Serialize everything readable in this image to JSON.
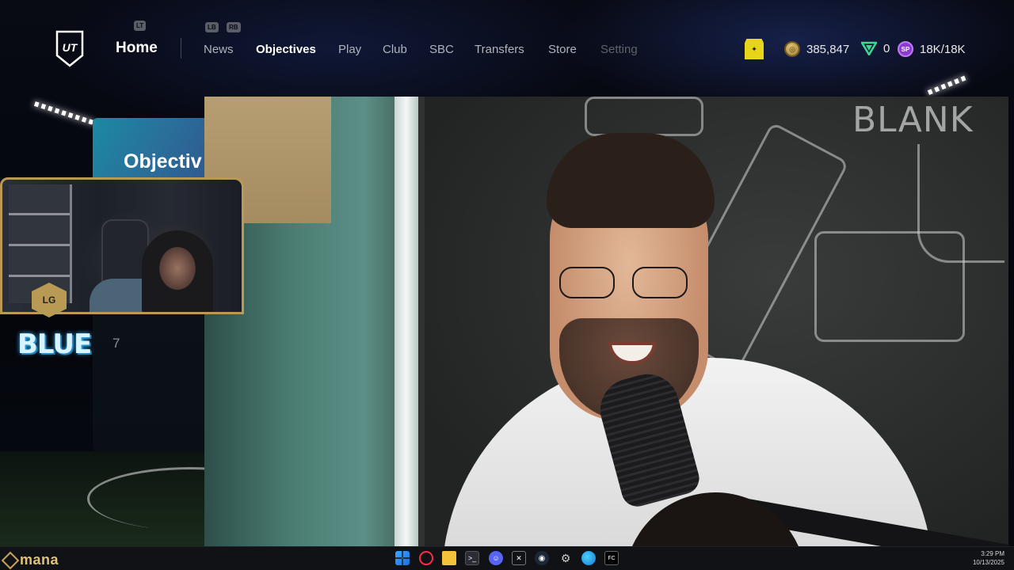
{
  "nav": {
    "home": "Home",
    "lt": "LT",
    "lb": "LB",
    "rb": "RB",
    "items": [
      "News",
      "Objectives",
      "Play",
      "Club",
      "SBC",
      "Transfers",
      "Store",
      "Setting"
    ],
    "active": "Objectives"
  },
  "currencies": {
    "coins": "385,847",
    "points": "0",
    "sp": "18K/18K",
    "sp_icon": "SP"
  },
  "objectives_card": {
    "title": "Objectiv"
  },
  "overlay": {
    "blue_text": "BLUE",
    "blue_number": "7"
  },
  "video": {
    "chalk_text": "BLANK"
  },
  "taskbar": {
    "brand": "mana",
    "time": "3:29 PM",
    "date": "10/13/2025"
  }
}
